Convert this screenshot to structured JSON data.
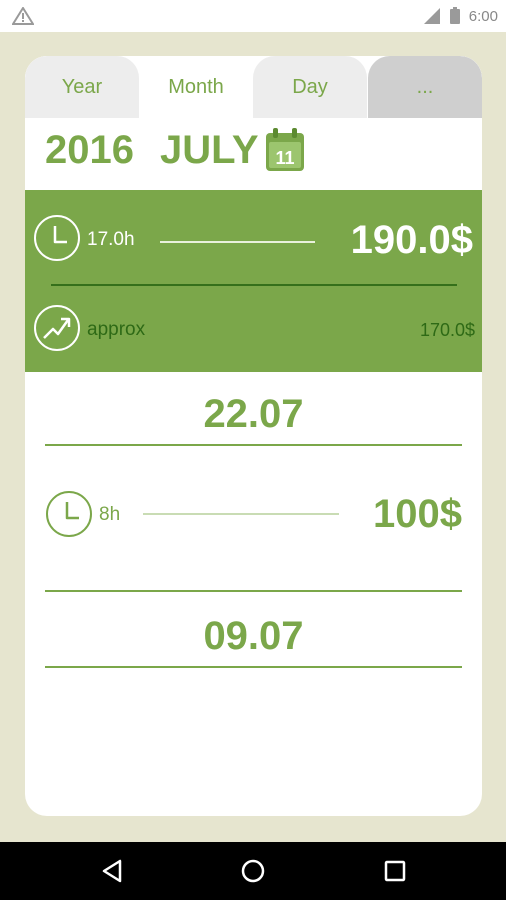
{
  "status_bar": {
    "time": "6:00",
    "icons": [
      "warning-icon",
      "signal-icon",
      "battery-icon"
    ]
  },
  "tabs": [
    {
      "label": "Year"
    },
    {
      "label": "Month"
    },
    {
      "label": "Day"
    },
    {
      "label": "..."
    }
  ],
  "period": {
    "year": "2016",
    "month": "JULY",
    "calendar_day": "11"
  },
  "summary": {
    "hours": "17.0h",
    "amount": "190.0$",
    "approx_label": "approx",
    "approx_amount": "170.0$"
  },
  "entries": [
    {
      "date": "22.07",
      "hours": "8h",
      "amount": "100$"
    },
    {
      "date": "09.07"
    }
  ],
  "colors": {
    "accent": "#7ba74a",
    "accent_dark": "#35701b",
    "background": "#e6e5cf",
    "card": "#ffffff"
  },
  "nav": {
    "icons": [
      "back-icon",
      "home-icon",
      "recents-icon"
    ]
  }
}
